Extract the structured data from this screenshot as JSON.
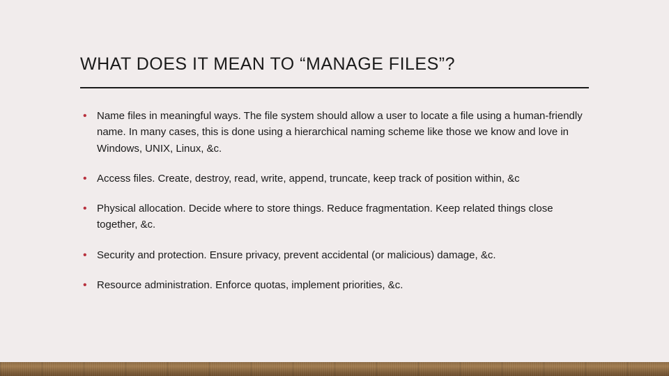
{
  "slide": {
    "title": "WHAT DOES IT MEAN TO “MANAGE FILES”?",
    "bullets": [
      "Name files in meaningful ways. The file system should allow a user to locate a file using a human-friendly name. In many cases, this is done using a hierarchical naming scheme like those we know and love in Windows, UNIX, Linux, &c.",
      "Access files. Create, destroy, read, write, append, truncate, keep track of position within, &c",
      "Physical allocation. Decide where to store things. Reduce fragmentation. Keep related things close together, &c.",
      "Security and protection. Ensure privacy, prevent accidental (or malicious) damage, &c.",
      "Resource administration. Enforce quotas, implement priorities, &c."
    ]
  },
  "colors": {
    "background": "#f1ecec",
    "text": "#1a1a1a",
    "accent": "#b8313e"
  }
}
